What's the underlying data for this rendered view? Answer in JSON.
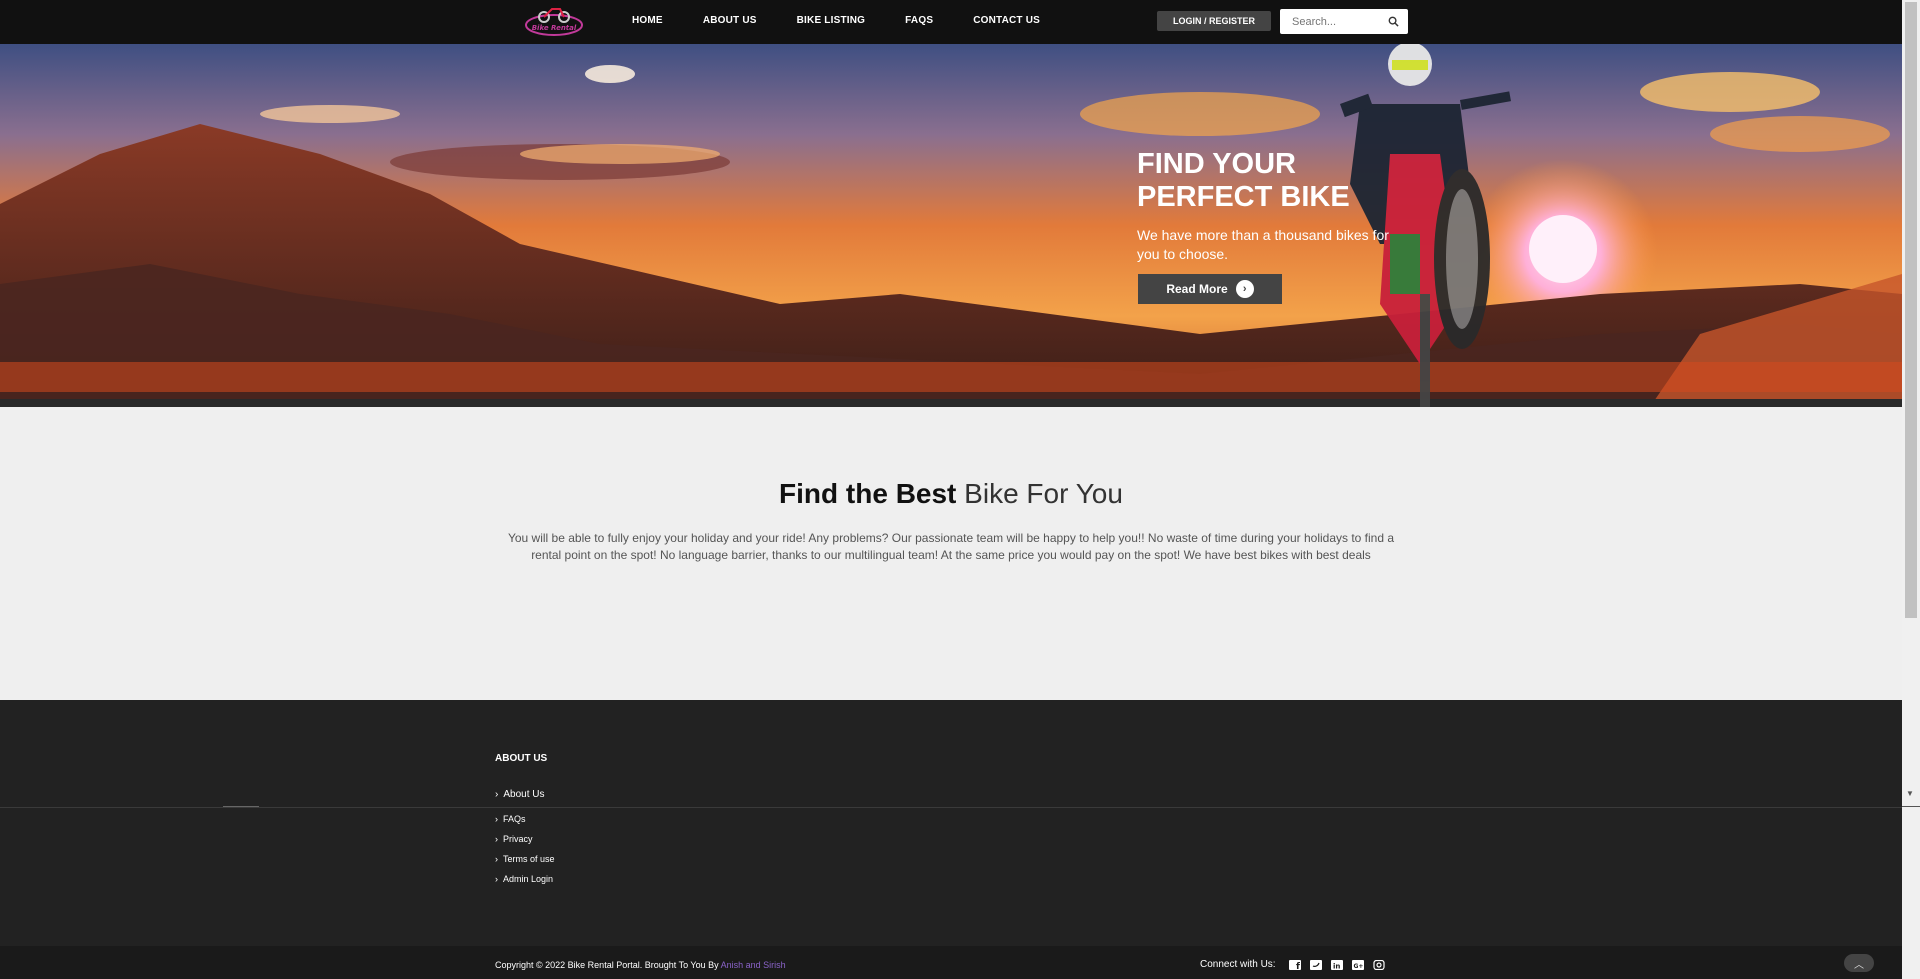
{
  "nav": {
    "logo_text": "Bike Rental",
    "links": [
      "HOME",
      "ABOUT US",
      "BIKE LISTING",
      "FAQS",
      "CONTACT US"
    ],
    "login_label": "LOGIN / REGISTER",
    "search_placeholder": "Search..."
  },
  "hero": {
    "title": "FIND YOUR PERFECT BIKE",
    "subtitle": "We have more than a thousand bikes for you to choose.",
    "button_label": "Read More",
    "button_icon": "arrow-circle-icon"
  },
  "intro": {
    "title_bold": "Find the Best",
    "title_light": "Bike For You",
    "text": "You will be able to fully enjoy your holiday and your ride! Any problems? Our passionate team will be happy to help you!! No waste of time during your holidays to find a rental point on the spot! No language barrier, thanks to our multilingual team! At the same price you would pay on the spot! We have best bikes with best deals"
  },
  "footer": {
    "heading": "ABOUT US",
    "links": [
      "About Us",
      "FAQs",
      "Privacy",
      "Terms of use",
      "Admin Login"
    ],
    "copyright": "Copyright © 2022 Bike Rental Portal. Brought To You By",
    "authors": "Anish and Sirish",
    "connect_label": "Connect with Us:",
    "social_icons": [
      "facebook-icon",
      "twitter-icon",
      "linkedin-icon",
      "google-plus-icon",
      "instagram-icon"
    ]
  },
  "colors": {
    "navbar": "#111111",
    "footer": "#222222",
    "accent_link": "#8a63c9",
    "button": "#444444"
  }
}
